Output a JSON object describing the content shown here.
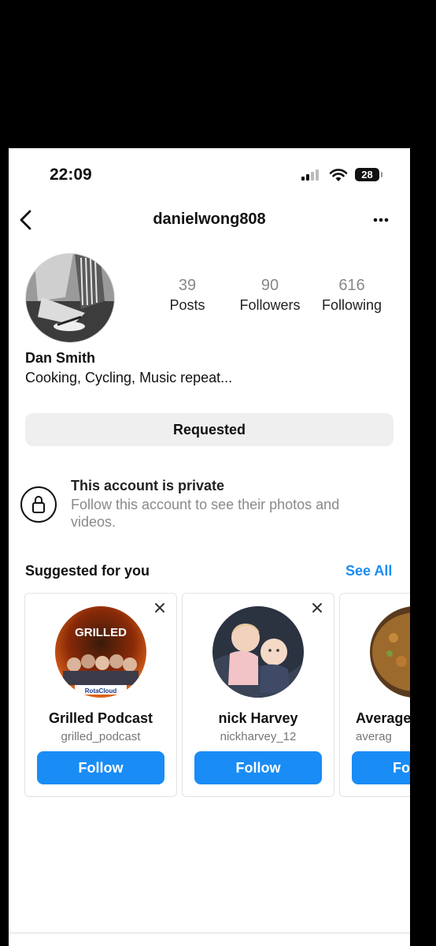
{
  "status_bar": {
    "time": "22:09",
    "battery": "28"
  },
  "header": {
    "username": "danielwong808"
  },
  "profile": {
    "stats": [
      {
        "value": "39",
        "label": "Posts"
      },
      {
        "value": "90",
        "label": "Followers"
      },
      {
        "value": "616",
        "label": "Following"
      }
    ],
    "display_name": "Dan Smith",
    "bio": "Cooking, Cycling, Music repeat...",
    "requested_label": "Requested"
  },
  "private_notice": {
    "title": "This account is private",
    "description": "Follow this account to see their photos and videos."
  },
  "suggestions": {
    "title": "Suggested for you",
    "see_all": "See All",
    "cards": [
      {
        "name": "Grilled Podcast",
        "handle": "grilled_podcast",
        "follow": "Follow",
        "logo_text": "GRILLED",
        "sponsor": "RotaCloud"
      },
      {
        "name": "nick Harvey",
        "handle": "nickharvey_12",
        "follow": "Follow"
      },
      {
        "name": "Average",
        "handle": "averag",
        "follow": "Fo"
      }
    ]
  },
  "colors": {
    "accent": "#1a8cf5",
    "muted_text": "#8a8a8a",
    "button_gray": "#efefef"
  }
}
